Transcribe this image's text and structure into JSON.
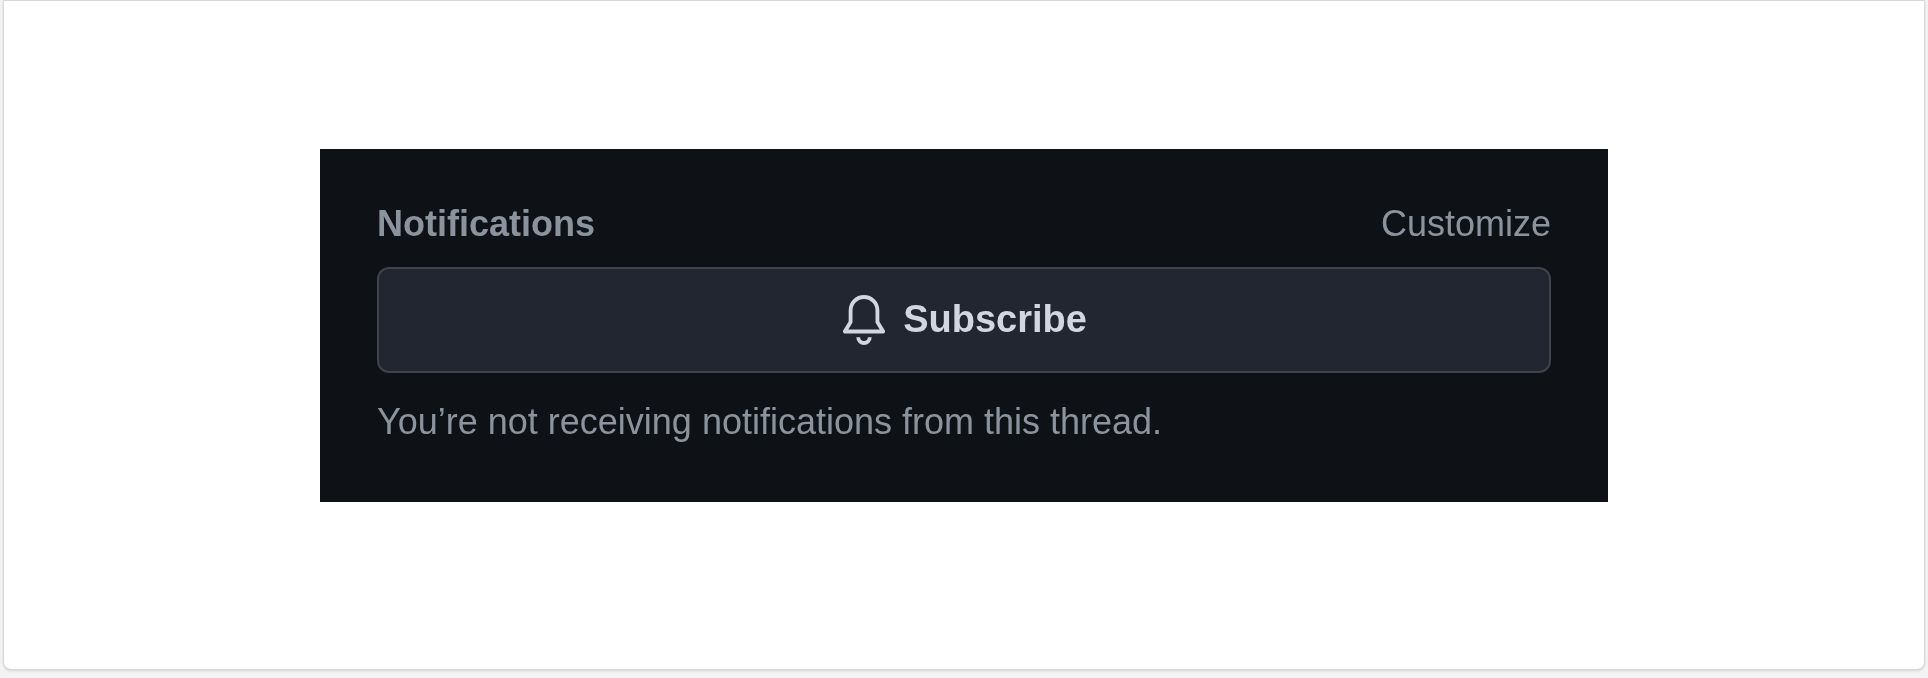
{
  "sidebar_section": {
    "title": "Notifications",
    "action": "Customize",
    "button": {
      "label": "Subscribe"
    },
    "status": "You’re not receiving notifications from this thread."
  }
}
